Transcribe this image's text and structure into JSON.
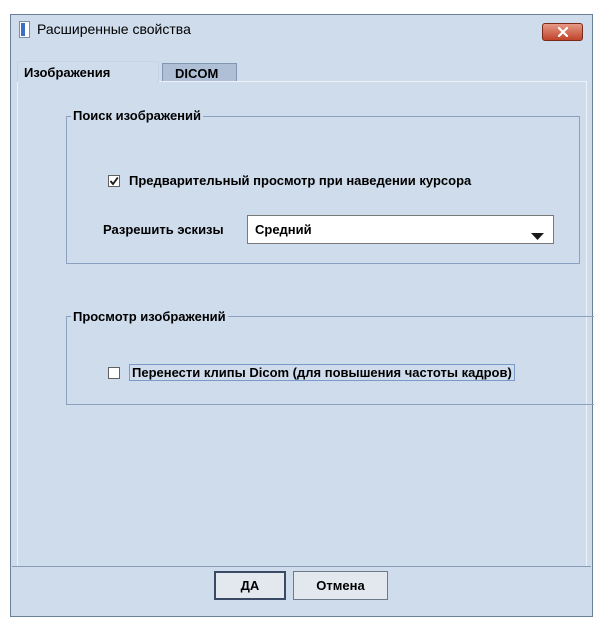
{
  "dialog": {
    "title": "Расширенные свойства"
  },
  "tabs": [
    {
      "label": "Изображения",
      "active": true
    },
    {
      "label": "DICOM",
      "active": false
    }
  ],
  "image_search": {
    "legend": "Поиск изображений",
    "preview_checkbox": {
      "label": "Предварительный просмотр при наведении курсора",
      "checked": true
    },
    "thumbnails": {
      "label": "Разрешить эскизы",
      "value": "Средний"
    }
  },
  "image_view": {
    "legend": "Просмотр изображений",
    "dicom_clips_checkbox": {
      "label": "Перенести клипы Dicom (для повышения частоты кадров)",
      "checked": false
    }
  },
  "buttons": {
    "ok": "ДА",
    "cancel": "Отмена"
  },
  "icons": {
    "app": "document-icon",
    "close": "close-x-icon",
    "dropdown": "triangle-down-icon",
    "check": "checkmark-icon"
  },
  "colors": {
    "dialog_bg": "#cfdcec",
    "close_button": "#c0432a",
    "inactive_tab": "#aebfd6",
    "group_border": "#8da0c0"
  }
}
